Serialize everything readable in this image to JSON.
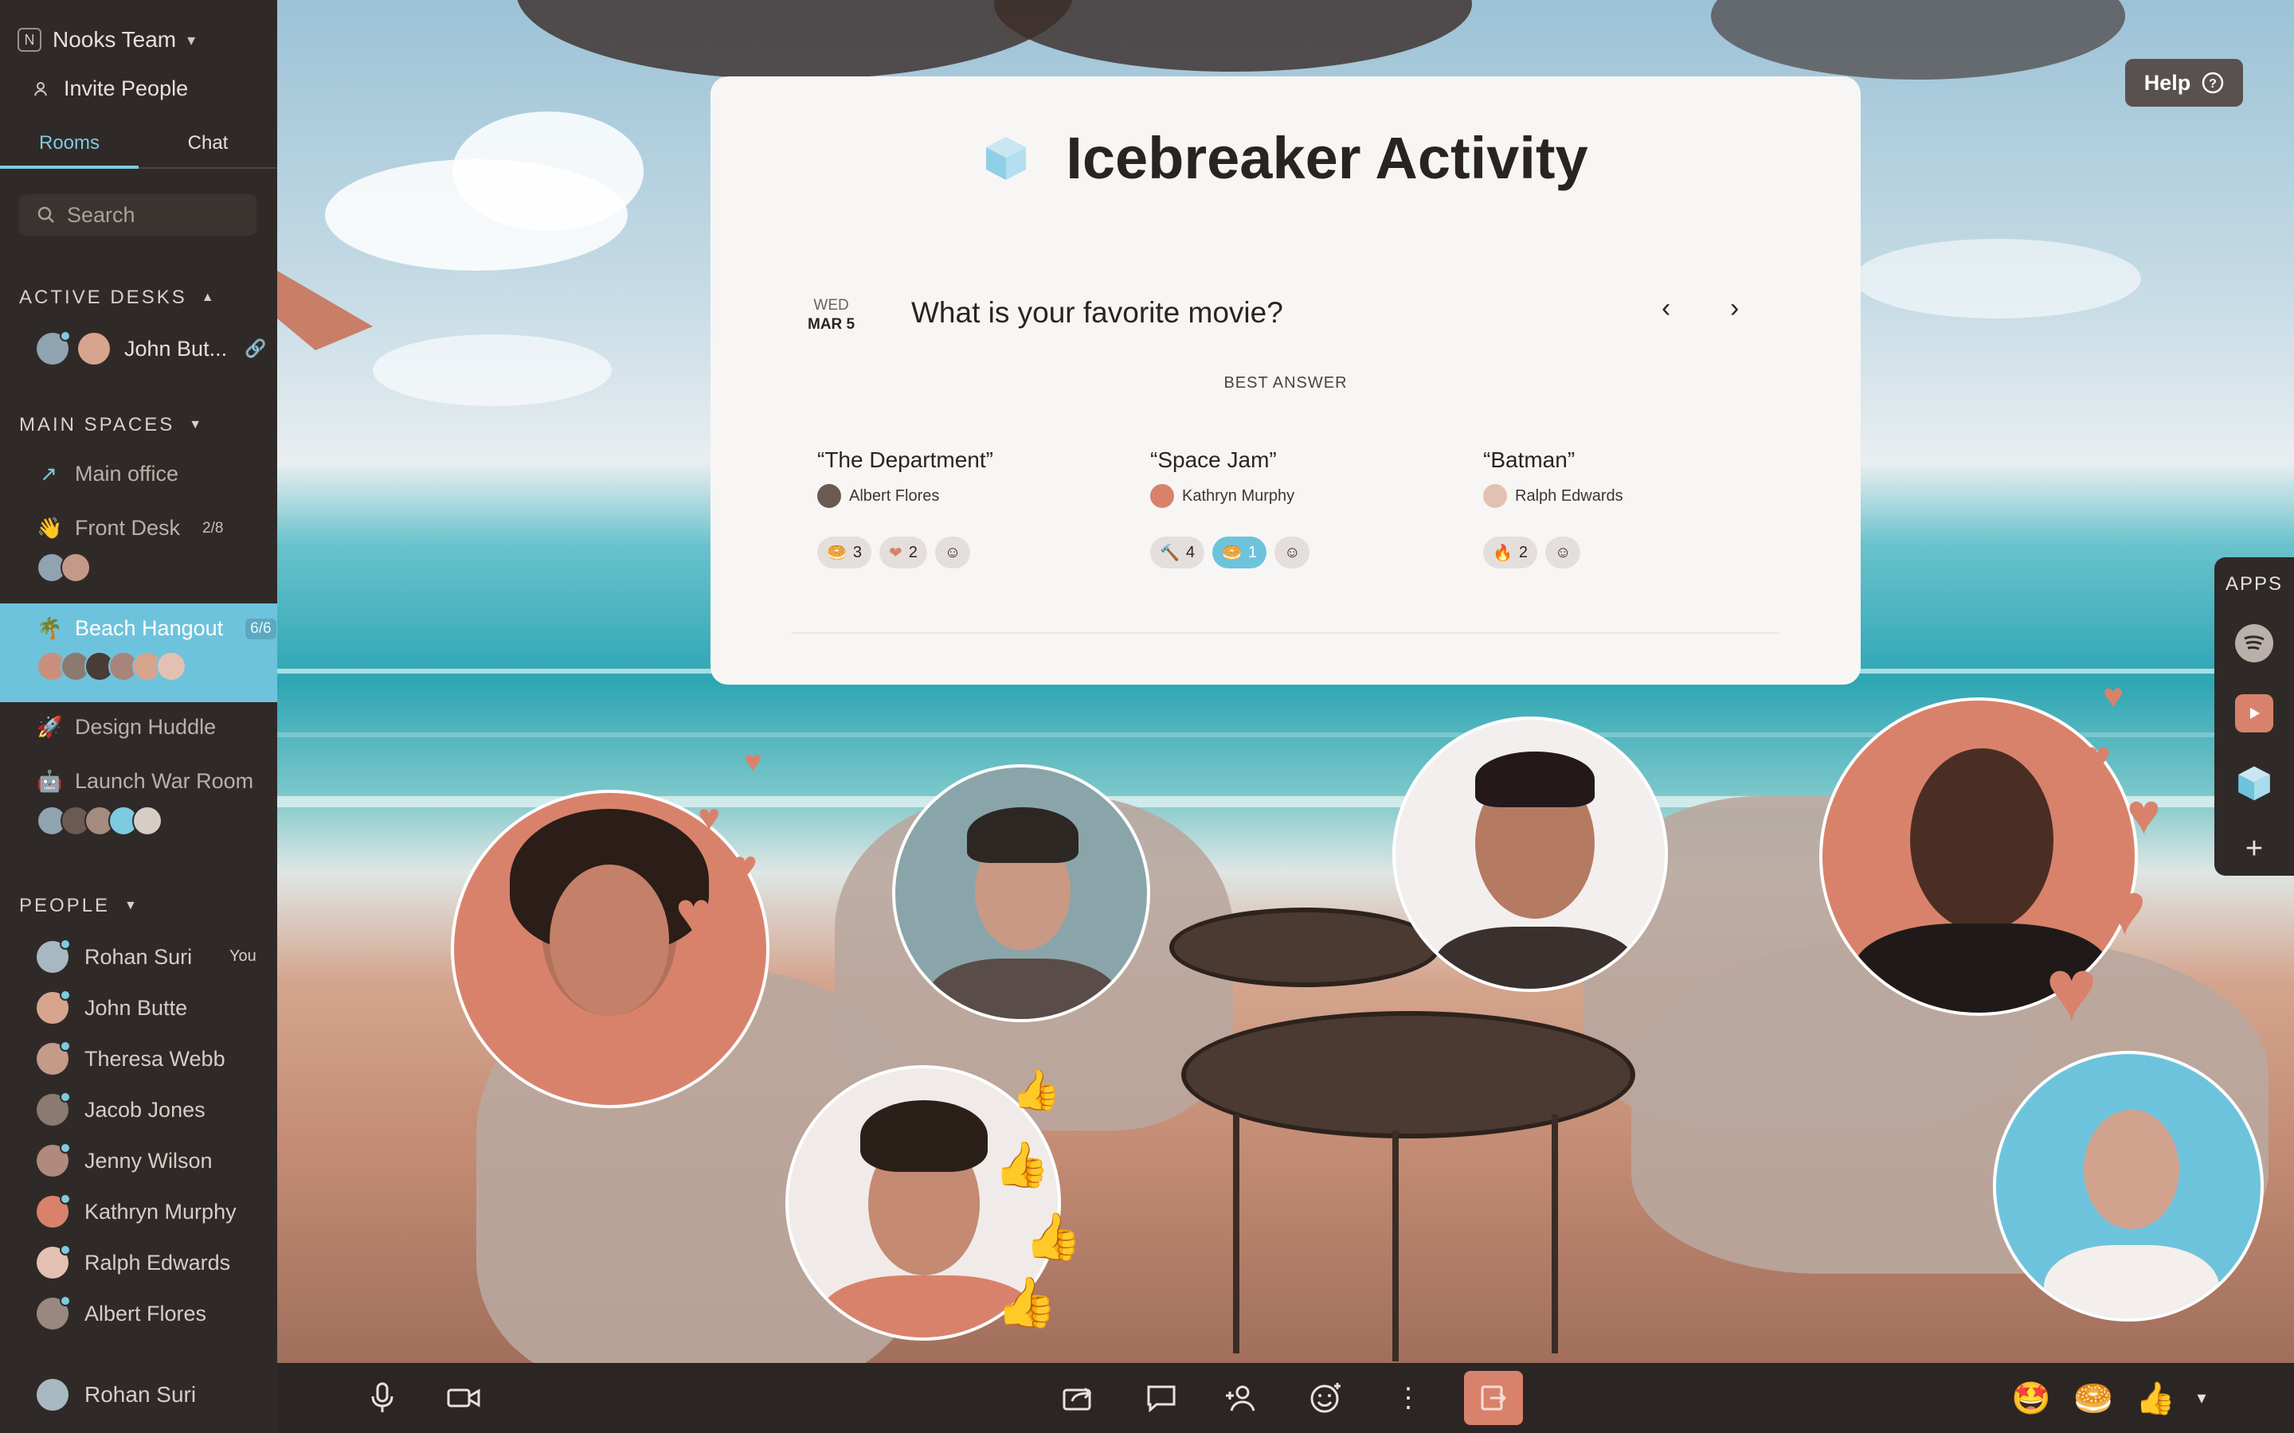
{
  "sidebar": {
    "team_logo": "N",
    "team_name": "Nooks Team",
    "invite_label": "Invite People",
    "tabs": [
      {
        "label": "Rooms"
      },
      {
        "label": "Chat"
      }
    ],
    "search_placeholder": "Search",
    "active_desks": {
      "heading": "ACTIVE DESKS",
      "user": "John But..."
    },
    "main_spaces": {
      "heading": "MAIN SPACES",
      "rooms": [
        {
          "emoji": "↗",
          "name": "Main office"
        },
        {
          "emoji": "👋",
          "name": "Front Desk",
          "count": "2/8"
        },
        {
          "emoji": "🌴",
          "name": "Beach Hangout",
          "count": "6/6"
        },
        {
          "emoji": "🚀",
          "name": "Design Huddle"
        },
        {
          "emoji": "🤖",
          "name": "Launch War Room"
        }
      ]
    },
    "people": {
      "heading": "PEOPLE",
      "you_label": "You",
      "list": [
        {
          "name": "Rohan Suri"
        },
        {
          "name": "John Butte"
        },
        {
          "name": "Theresa Webb"
        },
        {
          "name": "Jacob Jones"
        },
        {
          "name": "Jenny Wilson"
        },
        {
          "name": "Kathryn Murphy"
        },
        {
          "name": "Ralph Edwards"
        },
        {
          "name": "Albert Flores"
        }
      ]
    },
    "current_user": "Rohan Suri"
  },
  "card": {
    "title": "Icebreaker Activity",
    "date_day": "WED",
    "date": "MAR 5",
    "question": "What is your favorite movie?",
    "best_answer_label": "BEST ANSWER",
    "answers": [
      {
        "title": "“The Department”",
        "author": "Albert Flores",
        "reactions": [
          {
            "emoji": "🥯",
            "count": "3"
          },
          {
            "emoji": "❤",
            "count": "2"
          }
        ]
      },
      {
        "title": "“Space Jam”",
        "author": "Kathryn Murphy",
        "reactions": [
          {
            "emoji": "🔨",
            "count": "4"
          },
          {
            "emoji": "🥯",
            "count": "1"
          }
        ]
      },
      {
        "title": "“Batman”",
        "author": "Ralph Edwards",
        "reactions": [
          {
            "emoji": "🔥",
            "count": "2"
          }
        ]
      }
    ]
  },
  "help_label": "Help",
  "apps_label": "APPS",
  "colors": {
    "accent": "#6ec3dc",
    "sidebar_bg": "#2f2a28",
    "brand_coral": "#d9826b"
  },
  "icons": {
    "search": "search-icon",
    "help": "question-circle-icon",
    "spotify": "spotify-icon",
    "youtube": "youtube-icon",
    "cube": "cube-icon"
  }
}
